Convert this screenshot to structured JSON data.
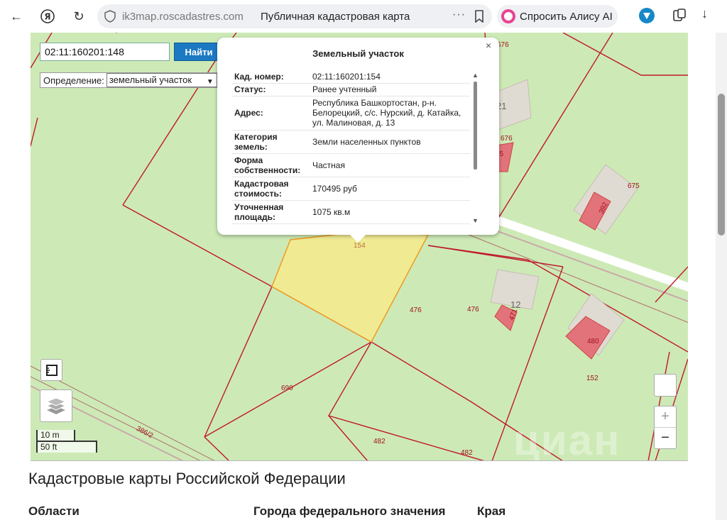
{
  "browser": {
    "url": "ik3map.roscadastres.com",
    "page_title": "Публичная кадастровая карта",
    "alice_label": "Спросить Алису AI",
    "menu_dots": "···"
  },
  "map": {
    "search_value": "02:11:160201:148",
    "find_label": "Найти",
    "definition_label": "Определение:",
    "definition_value": "земельный участок",
    "scale_metric": "10 m",
    "scale_imperial": "50 ft",
    "zoom_in": "+",
    "zoom_out": "−",
    "watermark": "циан",
    "labels": {
      "l676a": "676",
      "l676b": "676",
      "l21": "21",
      "l675": "675",
      "l392": "392",
      "l154": "154",
      "l476a": "476",
      "l476b": "476",
      "l12": "12",
      "l471": "471",
      "l480": "480",
      "l152": "152",
      "l690": "690",
      "l386": "386/2",
      "l482a": "482",
      "l482b": "482",
      "l35": "35"
    }
  },
  "popup": {
    "title": "Земельный участок",
    "close": "×",
    "rows": [
      {
        "k": "Кад. номер:",
        "v": "02:11:160201:154"
      },
      {
        "k": "Статус:",
        "v": "Ранее учтенный"
      },
      {
        "k": "Адрес:",
        "v": "Республика Башкортостан, р-н. Белорецкий, с/с. Нурский, д. Катайка, ул. Малиновая, д. 13"
      },
      {
        "k": "Категория земель:",
        "v": "Земли населенных пунктов"
      },
      {
        "k": "Форма собственности:",
        "v": "Частная"
      },
      {
        "k": "Кадастровая стоимость:",
        "v": "170495 руб"
      },
      {
        "k": "Уточненная площадь:",
        "v": "1075 кв.м"
      }
    ]
  },
  "page": {
    "heading": "Кадастровые карты Российской Федерации",
    "col1": "Области",
    "col2": "Города федерального значения",
    "col3": "Края"
  }
}
